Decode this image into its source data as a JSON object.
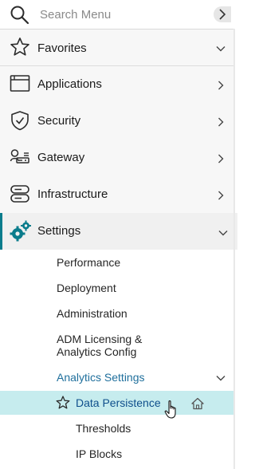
{
  "search": {
    "placeholder": "Search Menu"
  },
  "favorites": {
    "label": "Favorites"
  },
  "nav": {
    "applications": "Applications",
    "security": "Security",
    "gateway": "Gateway",
    "infrastructure": "Infrastructure",
    "settings": "Settings"
  },
  "settings_items": {
    "performance": "Performance",
    "deployment": "Deployment",
    "administration": "Administration",
    "adm_licensing_line1": "ADM Licensing &",
    "adm_licensing_line2": "Analytics Config",
    "analytics_settings": "Analytics Settings"
  },
  "analytics_items": {
    "data_persistence": "Data Persistence",
    "thresholds": "Thresholds",
    "ip_blocks": "IP Blocks"
  },
  "colors": {
    "accent": "#0a7c8c",
    "active_bg": "#c6ecee",
    "link": "#1f6f9c",
    "active_text": "#0f4f8c"
  },
  "icons": {
    "search": "search-icon",
    "favorites": "star-icon",
    "applications": "window-icon",
    "security": "shield-check-icon",
    "gateway": "gateway-icon",
    "infrastructure": "server-icon",
    "settings": "gears-icon",
    "home": "home-icon",
    "pointer": "hand-cursor-icon"
  }
}
